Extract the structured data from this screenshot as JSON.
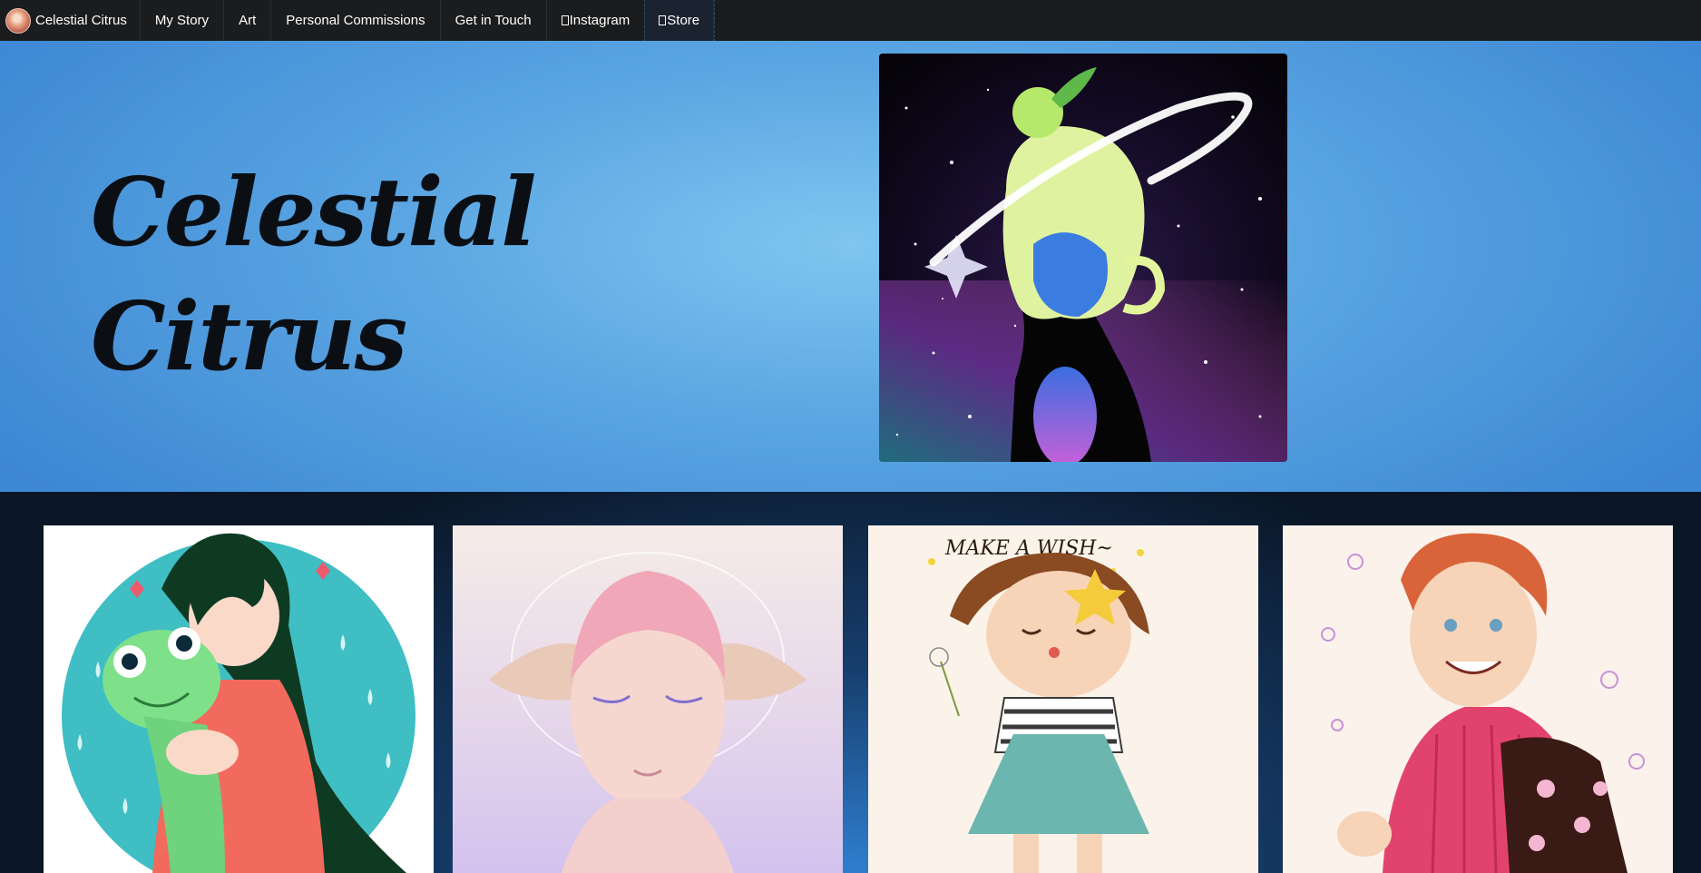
{
  "nav": {
    "brand": "Celestial Citrus",
    "items": [
      {
        "label": "My Story"
      },
      {
        "label": "Art"
      },
      {
        "label": "Personal Commissions"
      },
      {
        "label": "Get in Touch"
      },
      {
        "label": "Instagram",
        "icon": "instagram-icon"
      },
      {
        "label": "Store",
        "icon": "store-icon"
      }
    ]
  },
  "hero": {
    "title_line1": "Celestial",
    "title_line2": "Citrus"
  },
  "gallery": {
    "cards": [
      {
        "name": "girl-with-frog-plush"
      },
      {
        "name": "pastel-elf-portrait"
      },
      {
        "name": "make-a-wish-girl",
        "caption": "MAKE A WISH~"
      },
      {
        "name": "girl-with-flower-backpack"
      }
    ]
  },
  "colors": {
    "navbar": "#1b1c1d",
    "hero_blue": "#5aa5e2",
    "gallery_dark": "#0a1626",
    "title": "#0b0f14"
  }
}
